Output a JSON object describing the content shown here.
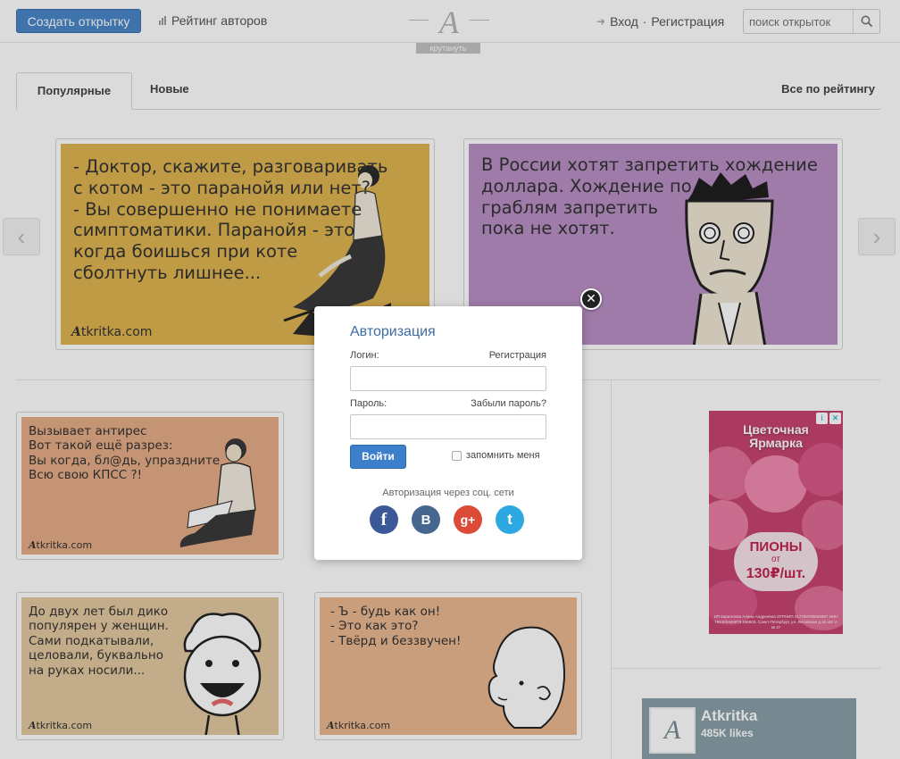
{
  "header": {
    "create_button": "Создать открытку",
    "rating_link": "Рейтинг авторов",
    "logo_letter": "A",
    "spin_label": "крутануть",
    "login_link": "Вход",
    "separator": "·",
    "register_link": "Регистрация",
    "search_placeholder": "поиск открыток"
  },
  "tabs": {
    "popular": "Популярные",
    "new": "Новые",
    "all_by_rating": "Все по рейтингу"
  },
  "cards": {
    "featured_1": {
      "text": "- Доктор, скажите, разговаривать\nс котом - это паранойя или нет?\n- Вы совершенно не понимаете\nсимптоматики. Паранойя - это\nкогда боишься при коте\nсболтнуть лишнее...",
      "signature_a": "A",
      "signature_rest": "tkritka.com",
      "bg": "#e0b552"
    },
    "featured_2": {
      "text": "В России хотят запретить хождение\nдоллара. Хождение по\nграблям запретить\nпока не хотят.",
      "bg": "#b890c5"
    },
    "grid_1": {
      "text": "Вызывает антирес\nВот такой ещё разрез:\nВы когда, бл@дь, упраздните\nВсю свою КПСС ?!",
      "signature_a": "A",
      "signature_rest": "tkritka.com",
      "bg": "#e6ad87"
    },
    "grid_2": {
      "text": "До двух лет был дико\nпопулярен у женщин.\nСами подкатывали,\nцеловали, буквально\nна руках носили...",
      "signature_a": "A",
      "signature_rest": "tkritka.com",
      "bg": "#e4c9a0"
    },
    "grid_3": {
      "text": "- Ъ - будь как он!\n- Это как это?\n- Твёрд и беззвучен!",
      "signature_a": "A",
      "signature_rest": "tkritka.com",
      "bg": "#eab892"
    }
  },
  "ad": {
    "title": "Цветочная\nЯрмарка",
    "product": "ПИОНЫ",
    "from": "от",
    "price": "130₽/шт.",
    "fine_print": "ИП Кириллова Алина Андреевна ОГРНИП 317784700045087 ИНН 783400483879 196603, Санкт-Петербург, ул. Литовская д.10 лит А кв 37"
  },
  "fb_widget": {
    "name": "Atkritka",
    "likes": "485K likes"
  },
  "modal": {
    "title": "Авторизация",
    "login_label": "Логин:",
    "register_link": "Регистрация",
    "password_label": "Пароль:",
    "forgot_link": "Забыли пароль?",
    "submit": "Войти",
    "remember": "запомнить меня",
    "social_label": "Авторизация через соц. сети",
    "social": [
      {
        "letter": "f",
        "color": "#3b5998"
      },
      {
        "letter": "B",
        "color": "#45668e"
      },
      {
        "letter": "g+",
        "color": "#dc4a38"
      },
      {
        "letter": "t",
        "color": "#2ea8e0"
      }
    ]
  }
}
